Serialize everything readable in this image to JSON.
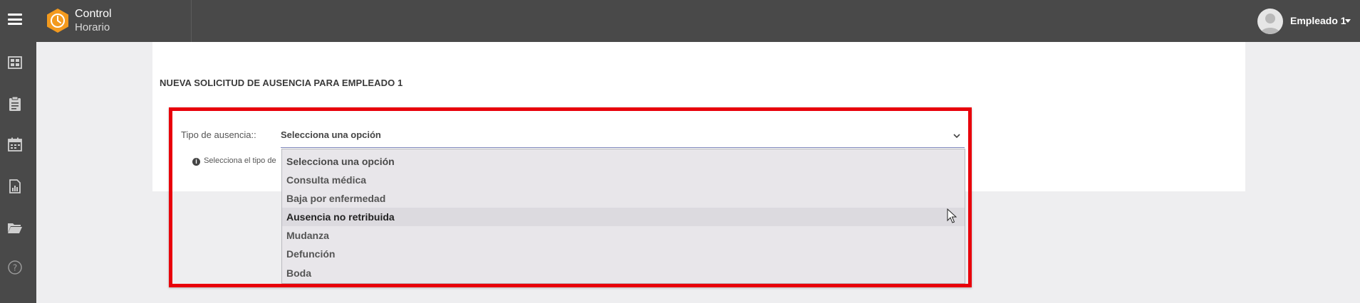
{
  "app": {
    "name_line1": "Control",
    "name_line2": "Horario"
  },
  "user": {
    "name": "Empleado 1"
  },
  "sidebar": {
    "icons": [
      "dashboard-icon",
      "clipboard-icon",
      "calendar-icon",
      "report-icon",
      "folder-icon",
      "help-icon"
    ]
  },
  "page": {
    "title": "NUEVA SOLICITUD DE AUSENCIA PARA EMPLEADO 1"
  },
  "form": {
    "absence_type_label": "Tipo de ausencia::",
    "selected_value": "Selecciona una opción",
    "help_text": "Selecciona el tipo de",
    "options": [
      "Selecciona una opción",
      "Consulta médica",
      "Baja por enfermedad",
      "Ausencia no retribuida",
      "Mudanza",
      "Defunción",
      "Boda"
    ],
    "hovered_option": "Ausencia no retribuida"
  },
  "colors": {
    "topbar": "#494949",
    "accent_logo": "#f39a1e",
    "highlight": "#e8000b",
    "select_underline": "#7b83b9"
  }
}
